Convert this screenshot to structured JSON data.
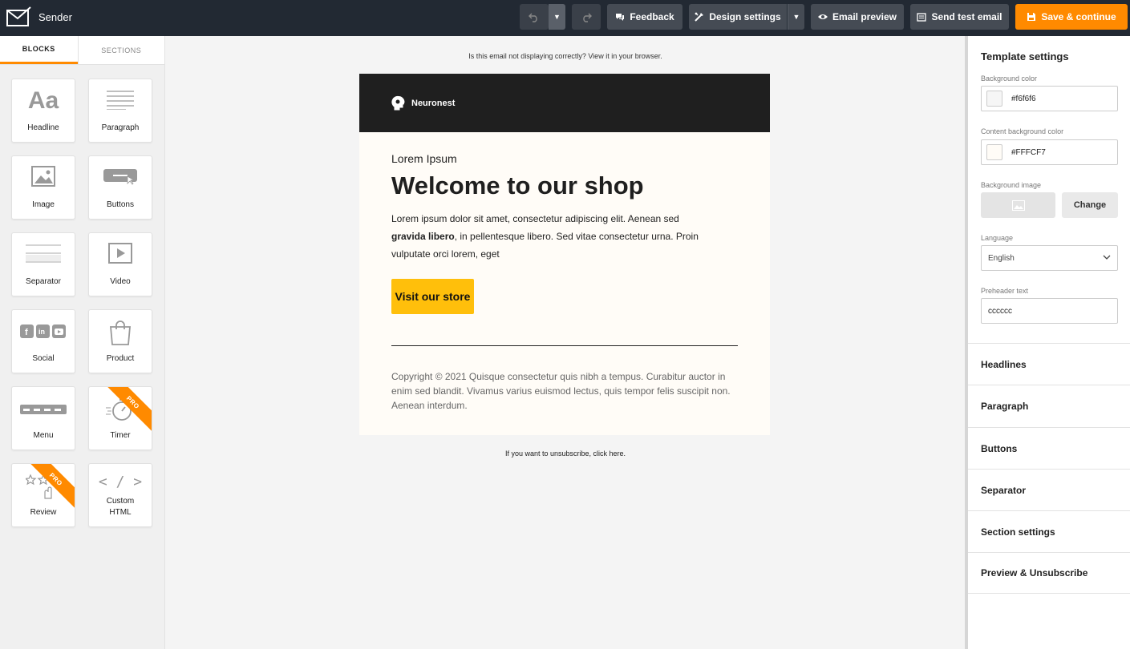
{
  "app": {
    "name": "Sender"
  },
  "toolbar": {
    "feedback": "Feedback",
    "design_settings": "Design settings",
    "email_preview": "Email preview",
    "send_test": "Send test email",
    "save": "Save & continue",
    "accent": "#ff8a00"
  },
  "left": {
    "tabs": [
      "BLOCKS",
      "SECTIONS"
    ],
    "active_tab": "BLOCKS",
    "blocks": [
      {
        "label": "Headline",
        "icon": "headline-icon"
      },
      {
        "label": "Paragraph",
        "icon": "paragraph-icon"
      },
      {
        "label": "Image",
        "icon": "image-icon"
      },
      {
        "label": "Buttons",
        "icon": "button-icon"
      },
      {
        "label": "Separator",
        "icon": "separator-icon"
      },
      {
        "label": "Video",
        "icon": "video-icon"
      },
      {
        "label": "Social",
        "icon": "social-icon"
      },
      {
        "label": "Product",
        "icon": "shopping-bag-icon"
      },
      {
        "label": "Menu",
        "icon": "menu-icon"
      },
      {
        "label": "Timer",
        "icon": "stopwatch-icon",
        "badge": "PRO"
      },
      {
        "label": "Review",
        "icon": "stars-icon",
        "badge": "PRO"
      },
      {
        "label": "Custom HTML",
        "icon": "code-icon"
      }
    ]
  },
  "email": {
    "browser_note": "Is this email not displaying correctly? View it in your browser.",
    "brand": "Neuronest",
    "eyebrow": "Lorem Ipsum",
    "headline": "Welcome to our shop",
    "para_1": "Lorem ipsum dolor sit amet, consectetur adipiscing elit. Aenean sed ",
    "para_bold": "gravida libero",
    "para_2": ", in pellentesque libero. Sed vitae consectetur urna. Proin vulputate orci lorem, eget",
    "cta": "Visit our store",
    "copyright": "Copyright © 2021 Quisque consectetur quis nibh a tempus. Curabitur auctor in enim sed blandit. Vivamus varius euismod lectus, quis tempor felis suscipit non. Aenean interdum.",
    "unsubscribe": "If you want to unsubscribe, click here."
  },
  "settings": {
    "title": "Template settings",
    "bg_color_label": "Background color",
    "bg_color": "#f6f6f6",
    "content_bg_label": "Content background color",
    "content_bg": "#FFFCF7",
    "bg_image_label": "Background image",
    "change": "Change",
    "language_label": "Language",
    "language": "English",
    "preheader_label": "Preheader text",
    "preheader": "cccccc",
    "sections": [
      "Headlines",
      "Paragraph",
      "Buttons",
      "Separator",
      "Section settings",
      "Preview & Unsubscribe"
    ]
  }
}
